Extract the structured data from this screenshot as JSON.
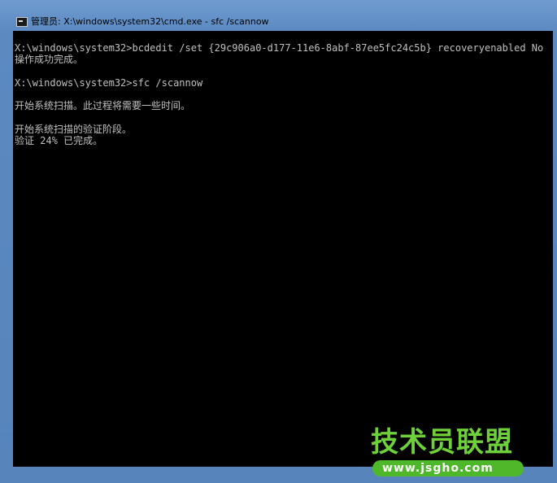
{
  "window": {
    "title": "管理员: X:\\windows\\system32\\cmd.exe - sfc  /scannow",
    "icon": "cmd-icon"
  },
  "console": {
    "lines": [
      "X:\\windows\\system32>bcdedit /set {29c906a0-d177-11e6-8abf-87ee5fc24c5b} recoveryenabled No",
      "操作成功完成。",
      "",
      "X:\\windows\\system32>sfc /scannow",
      "",
      "开始系统扫描。此过程将需要一些时间。",
      "",
      "开始系统扫描的验证阶段。",
      "验证 24% 已完成。"
    ]
  },
  "watermark": {
    "title": "技术员联盟",
    "url": "www.jsgho.com"
  },
  "colors": {
    "frame": "#5f8dc2",
    "console_bg": "#000000",
    "console_text": "#c0c0c0",
    "watermark_green": "#6fd13a"
  }
}
